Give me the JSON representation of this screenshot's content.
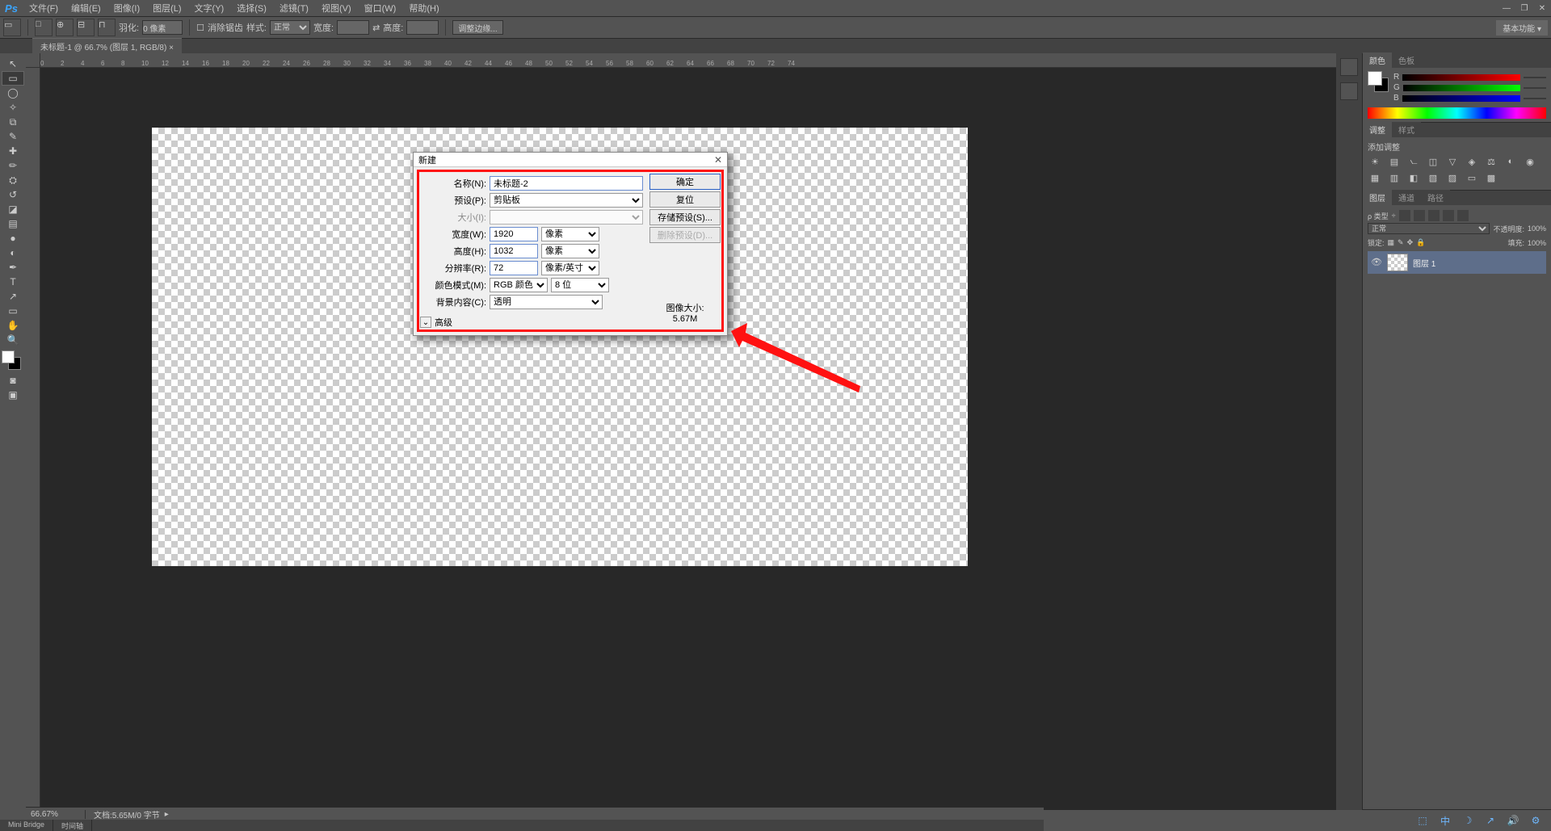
{
  "menu": {
    "items": [
      "文件(F)",
      "编辑(E)",
      "图像(I)",
      "图层(L)",
      "文字(Y)",
      "选择(S)",
      "滤镜(T)",
      "视图(V)",
      "窗口(W)",
      "帮助(H)"
    ]
  },
  "window_controls": {
    "min": "—",
    "max": "❐",
    "close": "✕"
  },
  "options": {
    "feather_label": "羽化:",
    "feather_value": "0 像素",
    "antialias": "消除锯齿",
    "style_label": "样式:",
    "style_value": "正常",
    "width_label": "宽度:",
    "height_label": "高度:",
    "adjust_btn": "调整边缘...",
    "basic": "基本功能"
  },
  "doc_tab": "未标题-1 @ 66.7% (图层 1, RGB/8) ×",
  "ruler_ticks": [
    "0",
    "2",
    "4",
    "6",
    "8",
    "10",
    "12",
    "14",
    "16",
    "18",
    "20",
    "22",
    "24",
    "26",
    "28",
    "30",
    "32",
    "34",
    "36",
    "38",
    "40",
    "42",
    "44",
    "46",
    "48",
    "50",
    "52",
    "54",
    "56",
    "58",
    "60",
    "62",
    "64",
    "66",
    "68",
    "70",
    "72",
    "74"
  ],
  "panels": {
    "color_tabs": [
      "颜色",
      "色板"
    ],
    "rgb": {
      "r": "R",
      "g": "G",
      "b": "B"
    },
    "adjust_tabs": [
      "调整",
      "样式"
    ],
    "adjust_title": "添加调整",
    "layer_tabs": [
      "图层",
      "通道",
      "路径"
    ],
    "layer": {
      "kind": "ρ 类型",
      "mode": "正常",
      "opacity_label": "不透明度:",
      "opacity": "100%",
      "lock_label": "锁定:",
      "fill_label": "填充:",
      "fill": "100%",
      "layer1": "图层 1"
    }
  },
  "status": {
    "zoom": "66.67%",
    "doc": "文档:5.65M/0 字节"
  },
  "bottom_tabs": [
    "Mini Bridge",
    "时间轴"
  ],
  "dialog": {
    "title": "新建",
    "name_label": "名称(N):",
    "name_value": "未标题-2",
    "preset_label": "预设(P):",
    "preset_value": "剪贴板",
    "size_label": "大小(I):",
    "width_label": "宽度(W):",
    "width_value": "1920",
    "width_unit": "像素",
    "height_label": "高度(H):",
    "height_value": "1032",
    "height_unit": "像素",
    "res_label": "分辨率(R):",
    "res_value": "72",
    "res_unit": "像素/英寸",
    "mode_label": "颜色模式(M):",
    "mode_value": "RGB 颜色",
    "depth": "8 位",
    "bg_label": "背景内容(C):",
    "bg_value": "透明",
    "adv": "高级",
    "ok": "确定",
    "reset": "复位",
    "save": "存储预设(S)...",
    "delete": "删除预设(D)...",
    "imgsize_label": "图像大小:",
    "imgsize": "5.67M"
  },
  "tray": [
    "⬚",
    "中",
    "☽",
    "↗",
    "🔊",
    "⚙"
  ]
}
